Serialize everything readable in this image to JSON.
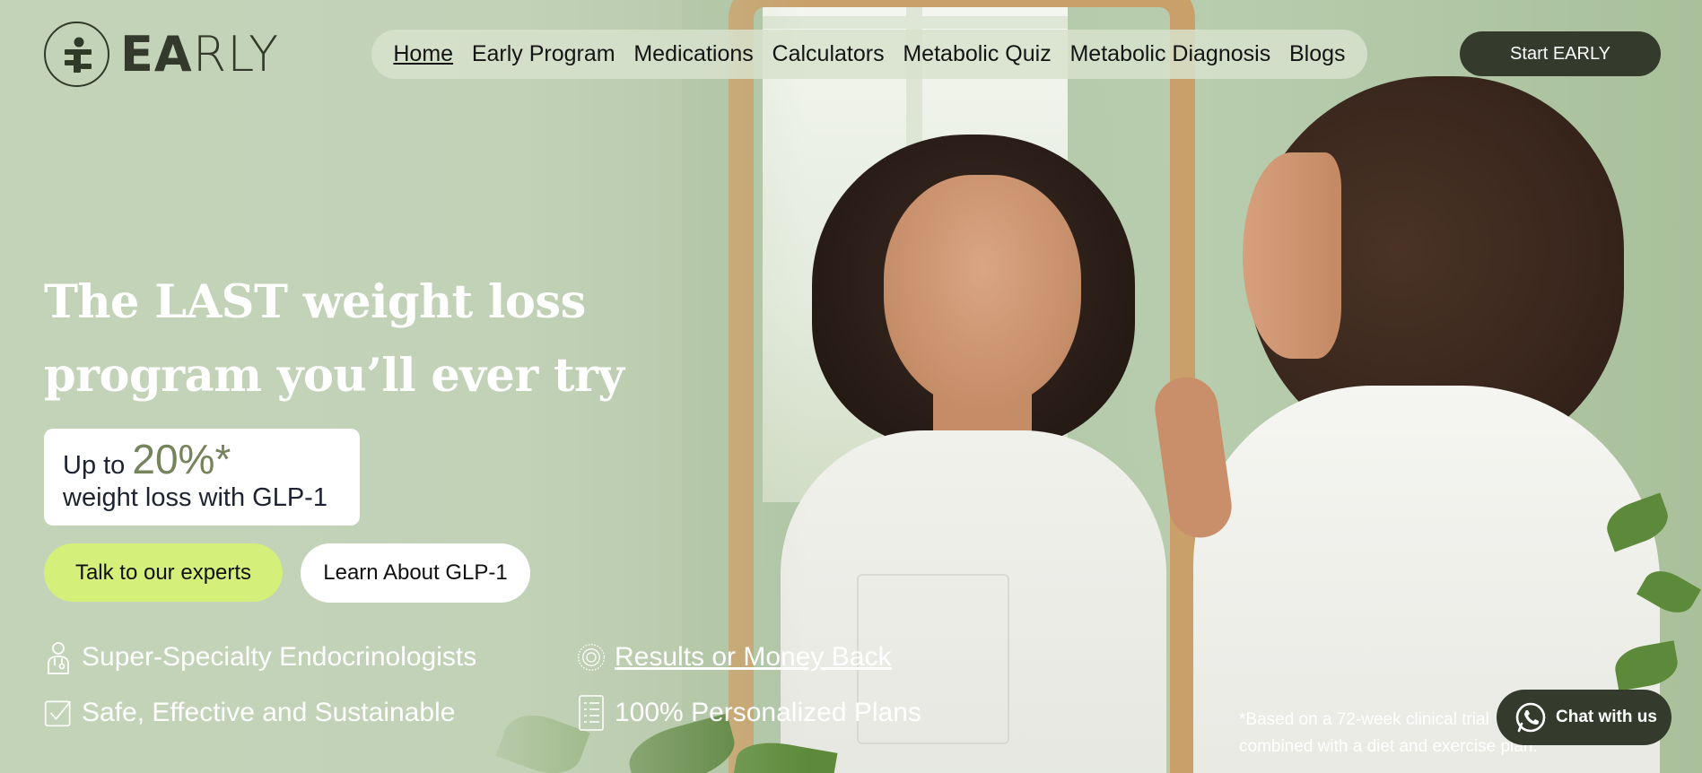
{
  "brand": {
    "name_bold": "EA",
    "name_light": "RLY"
  },
  "nav": {
    "items": [
      {
        "label": "Home",
        "active": true
      },
      {
        "label": "Early Program"
      },
      {
        "label": "Medications"
      },
      {
        "label": "Calculators"
      },
      {
        "label": "Metabolic Quiz"
      },
      {
        "label": "Metabolic Diagnosis"
      },
      {
        "label": "Blogs"
      }
    ],
    "cta_label": "Start EARLY"
  },
  "hero": {
    "title_line1": "The LAST weight loss",
    "title_line2": "program you’ll ever try",
    "stat": {
      "prefix": "Up to",
      "value": "20%*",
      "suffix": "weight loss with GLP-1"
    },
    "primary_button": "Talk to our experts",
    "secondary_button": "Learn About GLP-1",
    "features": [
      {
        "icon": "doctor-icon",
        "label": "Super-Specialty Endocrinologists"
      },
      {
        "icon": "guarantee-badge-icon",
        "label": "Results or Money Back"
      },
      {
        "icon": "checkbox-icon",
        "label": "Safe, Effective and Sustainable"
      },
      {
        "icon": "checklist-icon",
        "label": "100% Personalized Plans"
      }
    ]
  },
  "disclaimer": {
    "line1": "*Based on a 72-week clinical trial",
    "line2": "combined with a diet and exercise plan."
  },
  "chat": {
    "label": "Chat with us",
    "icon": "whatsapp-icon"
  },
  "colors": {
    "accent_lime": "#d4ef7a",
    "dark_olive": "#343b2c",
    "stat_green": "#75845c",
    "background_sage": "#c3d3b8"
  }
}
